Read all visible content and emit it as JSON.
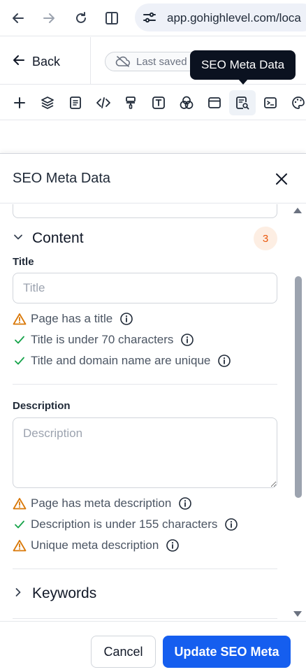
{
  "browser": {
    "url": "app.gohighlevel.com/loca",
    "icons": [
      "back-arrow-icon",
      "forward-arrow-icon",
      "reload-icon",
      "split-view-icon",
      "site-settings-icon"
    ]
  },
  "header": {
    "back_label": "Back",
    "saved_status": "Last saved",
    "tooltip": "SEO Meta Data"
  },
  "toolbar": {
    "icons": [
      "plus-icon",
      "layers-icon",
      "page-icon",
      "code-icon",
      "paint-roller-icon",
      "text-icon",
      "color-circles-icon",
      "browser-window-icon",
      "seo-meta-icon",
      "terminal-icon",
      "palette-icon"
    ],
    "active": "seo-meta-icon"
  },
  "panel": {
    "title": "SEO Meta Data",
    "content_section": {
      "label": "Content",
      "count": "3"
    },
    "title_field": {
      "label": "Title",
      "placeholder": "Title",
      "value": ""
    },
    "title_checks": [
      {
        "text": "Page has a title",
        "status": "warning"
      },
      {
        "text": "Title is under 70 characters",
        "status": "pass"
      },
      {
        "text": "Title and domain name are unique",
        "status": "pass"
      }
    ],
    "description_field": {
      "label": "Description",
      "placeholder": "Description",
      "value": ""
    },
    "description_checks": [
      {
        "text": "Page has meta description",
        "status": "warning"
      },
      {
        "text": "Description is under 155 characters",
        "status": "pass"
      },
      {
        "text": "Unique meta description",
        "status": "warning"
      }
    ],
    "keywords_section": {
      "label": "Keywords"
    }
  },
  "footer": {
    "cancel_label": "Cancel",
    "submit_label": "Update SEO Meta"
  },
  "colors": {
    "primary": "#155eef",
    "warning": "#d97706",
    "pass": "#16a34a",
    "badge_bg": "#fdeee3",
    "badge_text": "#ea580c"
  }
}
